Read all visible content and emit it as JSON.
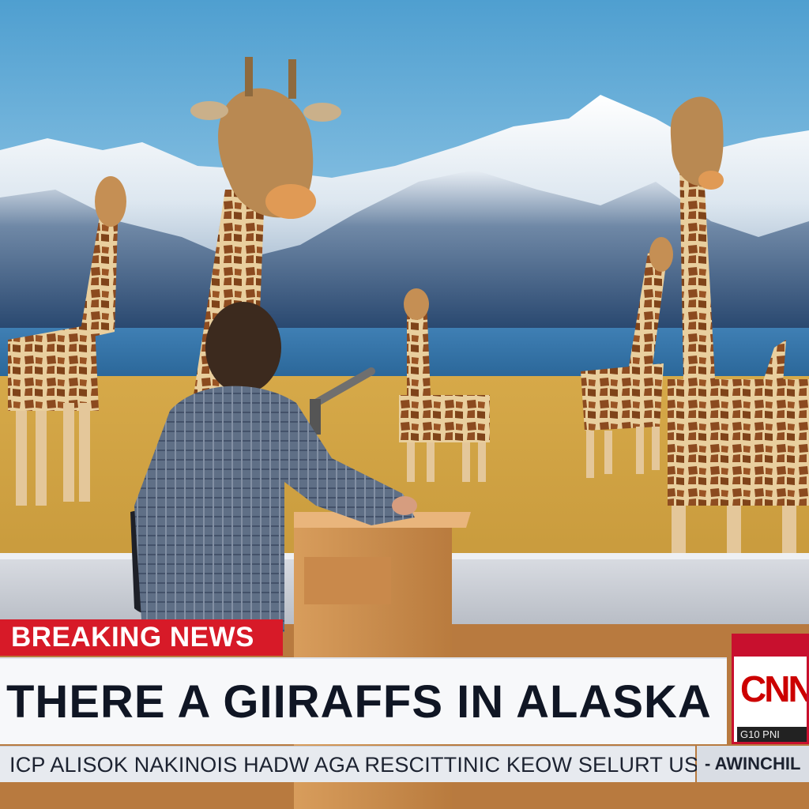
{
  "breaking_label": "BREAKING NEWS",
  "headline": "THERE A GIIRAFFS IN ALASKA",
  "ticker": {
    "text": "ICP ALISOK NAKINOIS HADW AGA RESCITTINIC KEOW SELURT US A REG FAT",
    "side": "- AWINCHIL"
  },
  "logo": {
    "text": "CNN",
    "subtext": "G10  PNI"
  },
  "colors": {
    "breaking_red": "#d71a28",
    "logo_red": "#cc0000",
    "headline_text": "#101624",
    "headline_bg": "#f7f8fa",
    "ticker_bg": "#e7eaef"
  }
}
